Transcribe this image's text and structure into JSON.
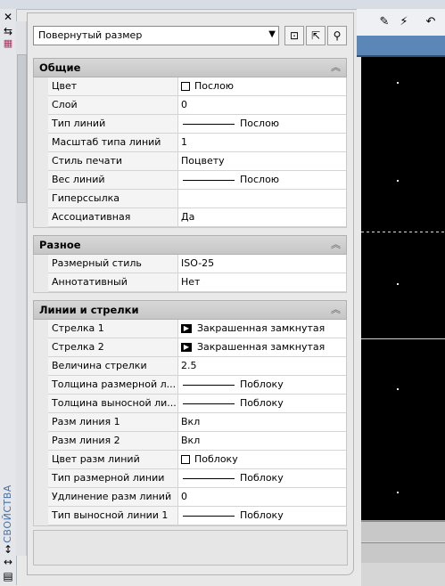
{
  "object_type": "Повернутый размер",
  "tools": [
    {
      "name": "quick-select-icon",
      "glyph": "⊡"
    },
    {
      "name": "select-objects-icon",
      "glyph": "⇱"
    },
    {
      "name": "pickadd-icon",
      "glyph": "⚲"
    }
  ],
  "side_title": "СВОЙСТВА",
  "sections": {
    "general": {
      "title": "Общие",
      "rows": [
        {
          "name": "Цвет",
          "value": "Послою"
        },
        {
          "name": "Слой",
          "value": "0"
        },
        {
          "name": "Тип линий",
          "value": "Послою"
        },
        {
          "name": "Масштаб типа линий",
          "value": "1"
        },
        {
          "name": "Стиль печати",
          "value": "Поцвету"
        },
        {
          "name": "Вес линий",
          "value": "Послою"
        },
        {
          "name": "Гиперссылка",
          "value": ""
        },
        {
          "name": "Ассоциативная",
          "value": "Да"
        }
      ]
    },
    "misc": {
      "title": "Разное",
      "rows": [
        {
          "name": "Размерный стиль",
          "value": "ISO-25"
        },
        {
          "name": "Аннотативный",
          "value": "Нет"
        }
      ]
    },
    "lines": {
      "title": "Линии и стрелки",
      "rows": [
        {
          "name": "Стрелка 1",
          "value": "Закрашенная замкнутая"
        },
        {
          "name": "Стрелка 2",
          "value": "Закрашенная замкнутая"
        },
        {
          "name": "Величина стрелки",
          "value": "2.5"
        },
        {
          "name": "Толщина размерной л...",
          "value": "Поблоку"
        },
        {
          "name": "Толщина выносной ли...",
          "value": "Поблоку"
        },
        {
          "name": "Разм линия 1",
          "value": "Вкл"
        },
        {
          "name": "Разм линия 2",
          "value": "Вкл"
        },
        {
          "name": "Цвет разм линий",
          "value": "Поблоку"
        },
        {
          "name": "Тип размерной линии",
          "value": "Поблоку"
        },
        {
          "name": "Удлинение разм линий",
          "value": "0"
        },
        {
          "name": "Тип выносной линии 1",
          "value": "Поблоку"
        }
      ]
    }
  },
  "description": ""
}
